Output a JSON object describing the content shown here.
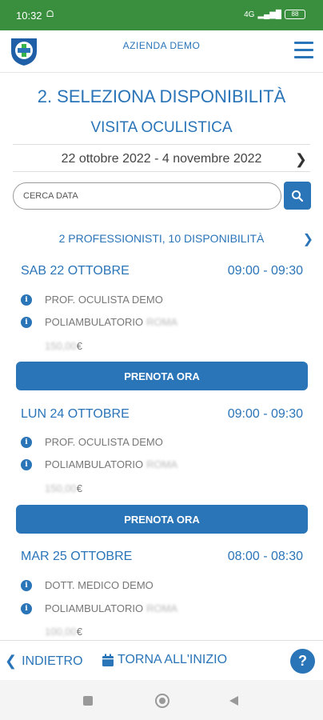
{
  "status_bar": {
    "time": "10:32",
    "left_icon": "nfc-icon",
    "network": "4G",
    "battery": "88"
  },
  "header": {
    "brand": "AZIENDA DEMO"
  },
  "page": {
    "step_title": "2. SELEZIONA DISPONIBILITÀ",
    "subtitle": "VISITA OCULISTICA",
    "date_range": "22 ottobre 2022 - 4 novembre 2022"
  },
  "search": {
    "placeholder": "CERCA DATA"
  },
  "summary": "2 PROFESSIONISTI, 10 DISPONIBILITÀ",
  "slots": [
    {
      "date": "SAB 22 OTTOBRE",
      "time": "09:00 - 09:30",
      "professional": "PROF. OCULISTA DEMO",
      "location": "POLIAMBULATORIO",
      "location_blur": "ROMA",
      "price_blur": "150,00",
      "price_currency": "€",
      "book_label": "PRENOTA ORA"
    },
    {
      "date": "LUN 24 OTTOBRE",
      "time": "09:00 - 09:30",
      "professional": "PROF. OCULISTA DEMO",
      "location": "POLIAMBULATORIO",
      "location_blur": "ROMA",
      "price_blur": "150,00",
      "price_currency": "€",
      "book_label": "PRENOTA ORA"
    },
    {
      "date": "MAR 25 OTTOBRE",
      "time": "08:00 - 08:30",
      "professional": "DOTT. MEDICO DEMO",
      "location": "POLIAMBULATORIO",
      "location_blur": "ROMA",
      "price_blur": "100,00",
      "price_currency": "€"
    }
  ],
  "footer": {
    "back_label": "INDIETRO",
    "home_label": "TORNA ALL'INIZIO",
    "help_label": "?"
  },
  "colors": {
    "accent": "#2a74b8",
    "status_bar": "#3a8f3e"
  }
}
